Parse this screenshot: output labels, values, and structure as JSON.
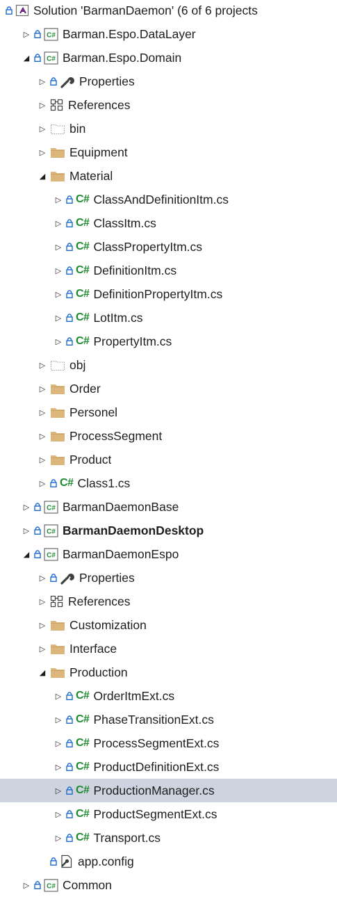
{
  "solution_explorer": {
    "colors": {
      "selection": "#cdd3df",
      "folder": "#dcb67a",
      "csharp": "#1e8a2e",
      "lock": "#1c6cd0"
    },
    "rows": [
      {
        "label": "Solution 'BarmanDaemon' (6 of 6 projects",
        "icon": "solution-icon",
        "expander": "none",
        "lock": true,
        "indent": 0
      },
      {
        "label": "Barman.Espo.DataLayer",
        "icon": "csharp-project-icon",
        "expander": "collapsed",
        "lock": true,
        "indent": 1
      },
      {
        "label": "Barman.Espo.Domain",
        "icon": "csharp-project-icon",
        "expander": "expanded",
        "lock": true,
        "indent": 1
      },
      {
        "label": "Properties",
        "icon": "wrench-icon",
        "expander": "collapsed",
        "lock": true,
        "indent": 2
      },
      {
        "label": "References",
        "icon": "references-icon",
        "expander": "collapsed",
        "lock": false,
        "indent": 2
      },
      {
        "label": "bin",
        "icon": "hidden-folder-icon",
        "expander": "collapsed",
        "lock": false,
        "indent": 2
      },
      {
        "label": "Equipment",
        "icon": "folder-icon",
        "expander": "collapsed",
        "lock": false,
        "indent": 2
      },
      {
        "label": "Material",
        "icon": "folder-icon",
        "expander": "expanded",
        "lock": false,
        "indent": 2
      },
      {
        "label": "ClassAndDefinitionItm.cs",
        "icon": "csharp-file-icon",
        "expander": "collapsed",
        "lock": true,
        "indent": 3
      },
      {
        "label": "ClassItm.cs",
        "icon": "csharp-file-icon",
        "expander": "collapsed",
        "lock": true,
        "indent": 3
      },
      {
        "label": "ClassPropertyItm.cs",
        "icon": "csharp-file-icon",
        "expander": "collapsed",
        "lock": true,
        "indent": 3
      },
      {
        "label": "DefinitionItm.cs",
        "icon": "csharp-file-icon",
        "expander": "collapsed",
        "lock": true,
        "indent": 3
      },
      {
        "label": "DefinitionPropertyItm.cs",
        "icon": "csharp-file-icon",
        "expander": "collapsed",
        "lock": true,
        "indent": 3
      },
      {
        "label": "LotItm.cs",
        "icon": "csharp-file-icon",
        "expander": "collapsed",
        "lock": true,
        "indent": 3
      },
      {
        "label": "PropertyItm.cs",
        "icon": "csharp-file-icon",
        "expander": "collapsed",
        "lock": true,
        "indent": 3
      },
      {
        "label": "obj",
        "icon": "hidden-folder-icon",
        "expander": "collapsed",
        "lock": false,
        "indent": 2
      },
      {
        "label": "Order",
        "icon": "folder-icon",
        "expander": "collapsed",
        "lock": false,
        "indent": 2
      },
      {
        "label": "Personel",
        "icon": "folder-icon",
        "expander": "collapsed",
        "lock": false,
        "indent": 2
      },
      {
        "label": "ProcessSegment",
        "icon": "folder-icon",
        "expander": "collapsed",
        "lock": false,
        "indent": 2
      },
      {
        "label": "Product",
        "icon": "folder-icon",
        "expander": "collapsed",
        "lock": false,
        "indent": 2
      },
      {
        "label": "Class1.cs",
        "icon": "csharp-file-icon",
        "expander": "collapsed",
        "lock": true,
        "indent": 2
      },
      {
        "label": "BarmanDaemonBase",
        "icon": "csharp-project-icon",
        "expander": "collapsed",
        "lock": true,
        "indent": 1
      },
      {
        "label": "BarmanDaemonDesktop",
        "icon": "csharp-project-icon",
        "expander": "collapsed",
        "lock": true,
        "indent": 1,
        "bold": true
      },
      {
        "label": "BarmanDaemonEspo",
        "icon": "csharp-project-icon",
        "expander": "expanded",
        "lock": true,
        "indent": 1
      },
      {
        "label": "Properties",
        "icon": "wrench-icon",
        "expander": "collapsed",
        "lock": true,
        "indent": 2
      },
      {
        "label": "References",
        "icon": "references-icon",
        "expander": "collapsed",
        "lock": false,
        "indent": 2
      },
      {
        "label": "Customization",
        "icon": "folder-icon",
        "expander": "collapsed",
        "lock": false,
        "indent": 2
      },
      {
        "label": "Interface",
        "icon": "folder-icon",
        "expander": "collapsed",
        "lock": false,
        "indent": 2
      },
      {
        "label": "Production",
        "icon": "folder-icon",
        "expander": "expanded",
        "lock": false,
        "indent": 2
      },
      {
        "label": "OrderItmExt.cs",
        "icon": "csharp-file-icon",
        "expander": "collapsed",
        "lock": true,
        "indent": 3
      },
      {
        "label": "PhaseTransitionExt.cs",
        "icon": "csharp-file-icon",
        "expander": "collapsed",
        "lock": true,
        "indent": 3
      },
      {
        "label": "ProcessSegmentExt.cs",
        "icon": "csharp-file-icon",
        "expander": "collapsed",
        "lock": true,
        "indent": 3
      },
      {
        "label": "ProductDefinitionExt.cs",
        "icon": "csharp-file-icon",
        "expander": "collapsed",
        "lock": true,
        "indent": 3
      },
      {
        "label": "ProductionManager.cs",
        "icon": "csharp-file-icon",
        "expander": "collapsed",
        "lock": true,
        "indent": 3,
        "selected": true
      },
      {
        "label": "ProductSegmentExt.cs",
        "icon": "csharp-file-icon",
        "expander": "collapsed",
        "lock": true,
        "indent": 3
      },
      {
        "label": "Transport.cs",
        "icon": "csharp-file-icon",
        "expander": "collapsed",
        "lock": true,
        "indent": 3
      },
      {
        "label": "app.config",
        "icon": "config-file-icon",
        "expander": "none",
        "lock": true,
        "indent": 2
      },
      {
        "label": "Common",
        "icon": "csharp-project-icon",
        "expander": "collapsed",
        "lock": true,
        "indent": 1
      }
    ]
  }
}
